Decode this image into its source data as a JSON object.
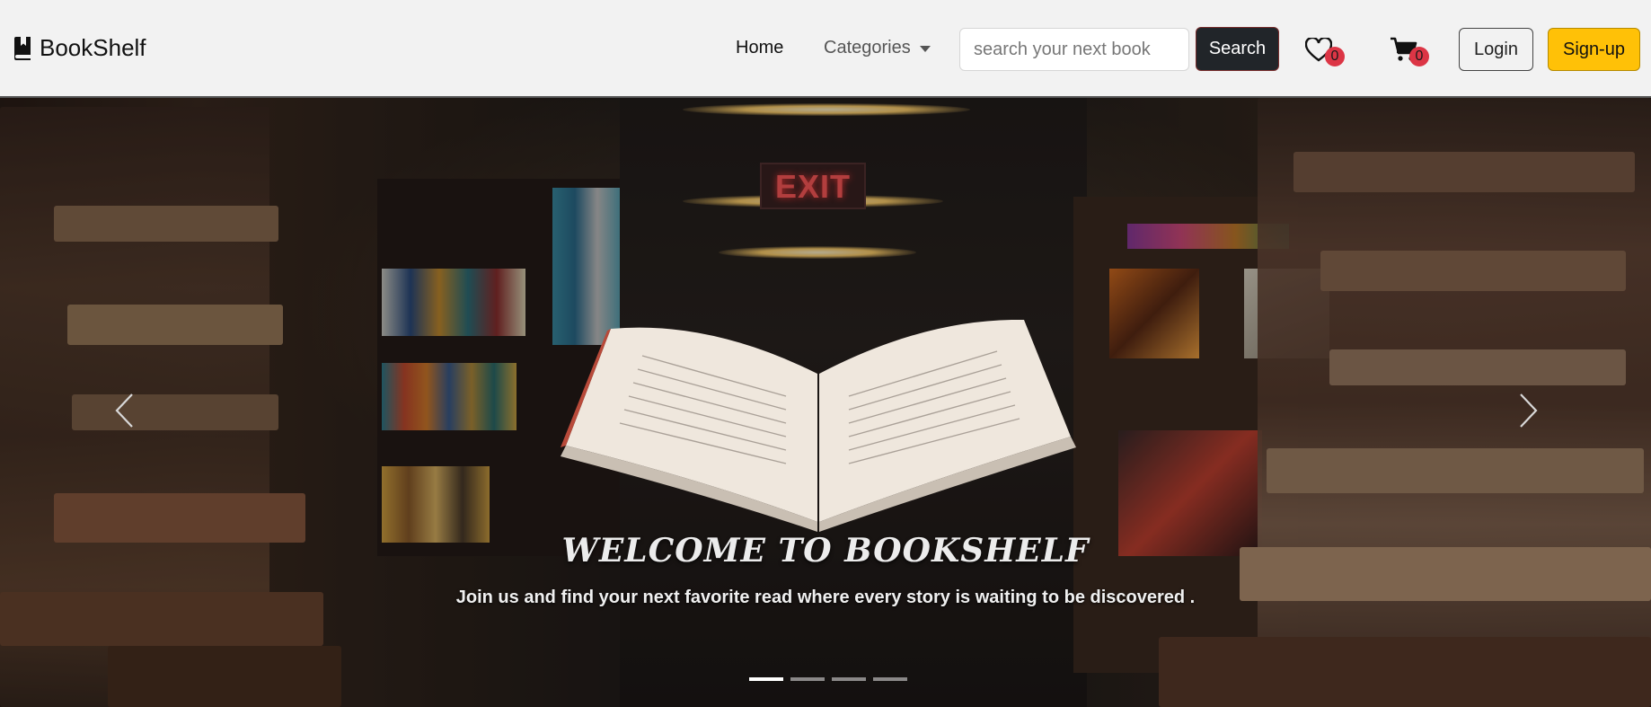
{
  "navbar": {
    "brand": "BookShelf",
    "brand_icon": "book-bookmark-icon",
    "links": {
      "home": "Home",
      "categories": "Categories"
    },
    "search": {
      "placeholder": "search your next book",
      "value": "",
      "button": "Search"
    },
    "wishlist": {
      "icon": "heart-icon",
      "count": "0"
    },
    "cart": {
      "icon": "cart-icon",
      "count": "0"
    },
    "login": "Login",
    "signup": "Sign-up"
  },
  "hero": {
    "exit_sign": "EXIT",
    "title": "WELCOME TO BOOKSHELF",
    "subtitle": "Join us and find your next favorite read where every story is waiting to be discovered .",
    "slides_total": 4,
    "active_slide": 1
  },
  "colors": {
    "navbar_bg": "#f2f2f2",
    "search_button_bg": "#212529",
    "badge_bg": "#dc3545",
    "signup_bg": "#ffc107"
  }
}
